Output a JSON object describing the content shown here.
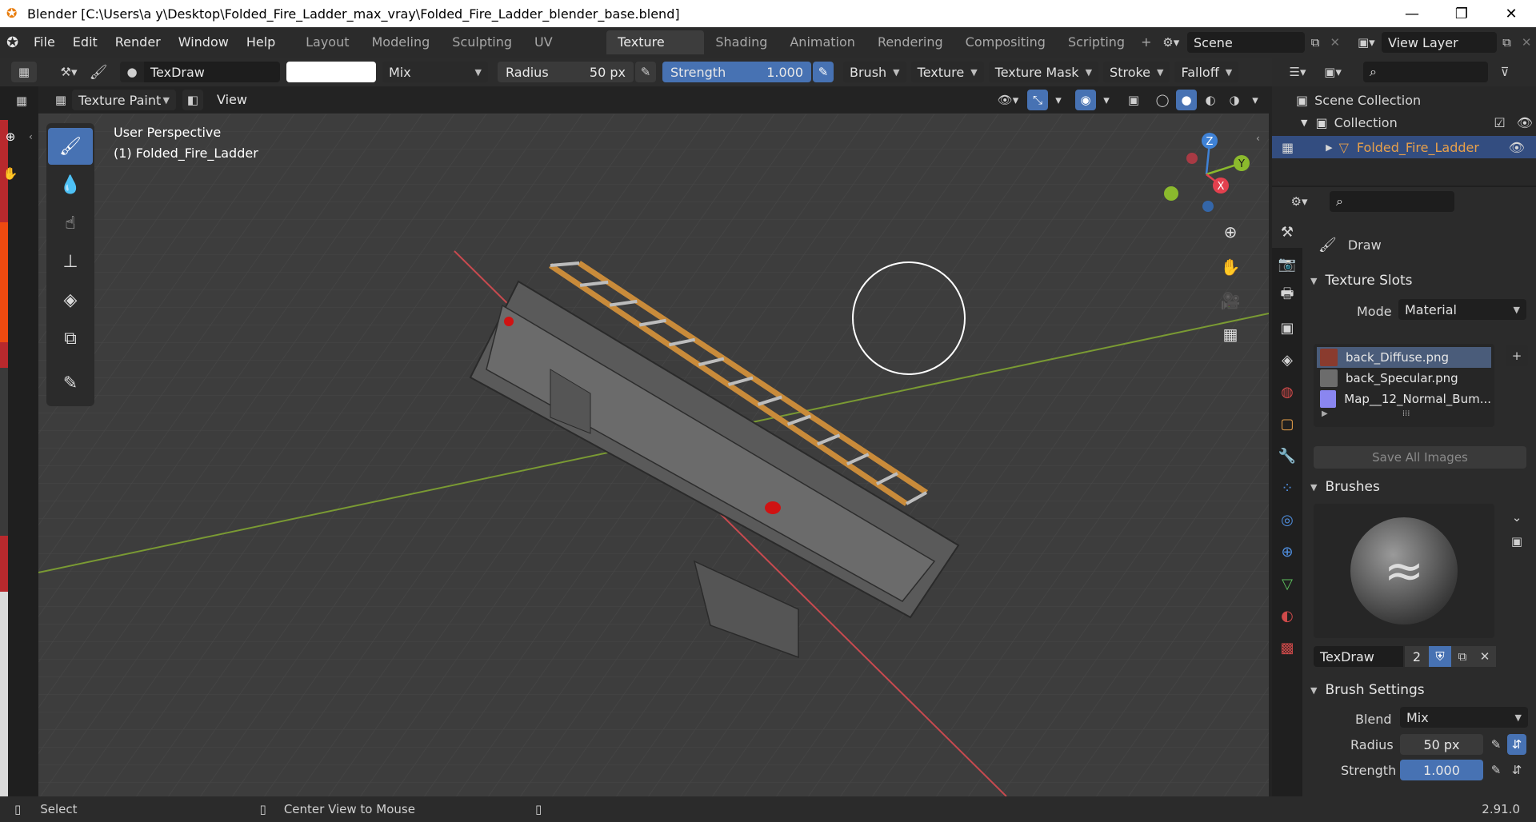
{
  "titlebar": {
    "title": "Blender [C:\\Users\\a y\\Desktop\\Folded_Fire_Ladder_max_vray\\Folded_Fire_Ladder_blender_base.blend]"
  },
  "menu": [
    "File",
    "Edit",
    "Render",
    "Window",
    "Help"
  ],
  "workspaces": {
    "tabs": [
      "Layout",
      "Modeling",
      "Sculpting",
      "UV Editing",
      "Texture Paint",
      "Shading",
      "Animation",
      "Rendering",
      "Compositing",
      "Scripting"
    ],
    "active": "Texture Paint",
    "add": "+"
  },
  "scene": {
    "label": "Scene",
    "view_layer": "View Layer"
  },
  "tool_header": {
    "brush_name": "TexDraw",
    "blend": "Mix",
    "radius_label": "Radius",
    "radius_value": "50 px",
    "strength_label": "Strength",
    "strength_value": "1.000",
    "strength_fraction": 1.0,
    "menus": [
      "Brush",
      "Texture",
      "Texture Mask",
      "Stroke",
      "Falloff"
    ]
  },
  "view_header": {
    "mode": "Texture Paint",
    "view": "View"
  },
  "viewport": {
    "perspective": "User Perspective",
    "object": "(1) Folded_Fire_Ladder",
    "gizmo_axes": [
      "Z",
      "Y",
      "X"
    ]
  },
  "outliner": {
    "scene_collection": "Scene Collection",
    "collection": "Collection",
    "object": "Folded_Fire_Ladder"
  },
  "properties": {
    "tool_name": "Draw",
    "texture_slots": {
      "title": "Texture Slots",
      "mode_label": "Mode",
      "mode_value": "Material",
      "slots": [
        "back_Diffuse.png",
        "back_Specular.png",
        "Map__12_Normal_Bum..."
      ],
      "save_all": "Save All Images",
      "slot_colors": [
        "#8a3b2e",
        "#6c6c6c",
        "#8a86f0"
      ]
    },
    "brushes": {
      "title": "Brushes",
      "brush": "TexDraw",
      "users": "2"
    },
    "brush_settings": {
      "title": "Brush Settings",
      "blend_label": "Blend",
      "blend_value": "Mix",
      "radius_label": "Radius",
      "radius_value": "50 px",
      "strength_label": "Strength",
      "strength_value": "1.000"
    }
  },
  "statusbar": {
    "select": "Select",
    "center": "Center View to Mouse",
    "version": "2.91.0"
  },
  "colors": {
    "accent": "#4772b3",
    "x_axis": "#e3404e",
    "y_axis": "#8bba2d",
    "z_axis": "#3f82d6",
    "object_orange": "#e8a04a"
  }
}
